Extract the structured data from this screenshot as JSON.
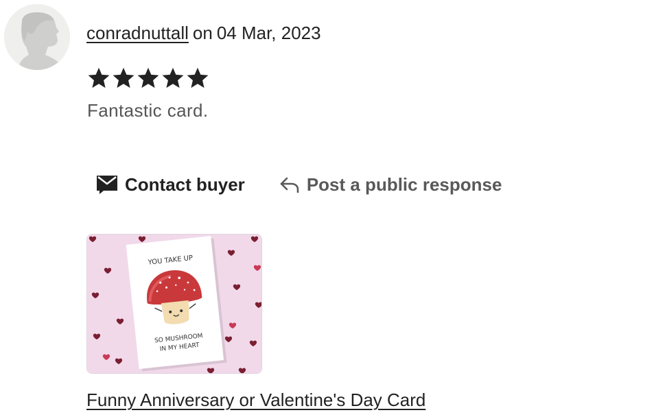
{
  "review": {
    "username": "conradnuttall",
    "on_word": "on",
    "date": "04 Mar, 2023",
    "rating": 5,
    "text": "Fantastic card."
  },
  "actions": {
    "contact_label": "Contact buyer",
    "respond_label": "Post a public response"
  },
  "product": {
    "title": "Funny Anniversary or Valentine's Day Card",
    "card_text_top": "YOU TAKE UP",
    "card_text_bottom_1": "SO MUSHROOM",
    "card_text_bottom_2": "IN MY HEART"
  },
  "icons": {
    "avatar": "default-user-avatar-icon",
    "star": "star-icon",
    "contact": "envelope-icon",
    "respond": "reply-arrow-icon"
  },
  "colors": {
    "text": "#222222",
    "muted": "#595959",
    "avatar_bg": "#efefed",
    "card_bg": "#f1d9ea",
    "mushroom_cap": "#c9393b"
  }
}
